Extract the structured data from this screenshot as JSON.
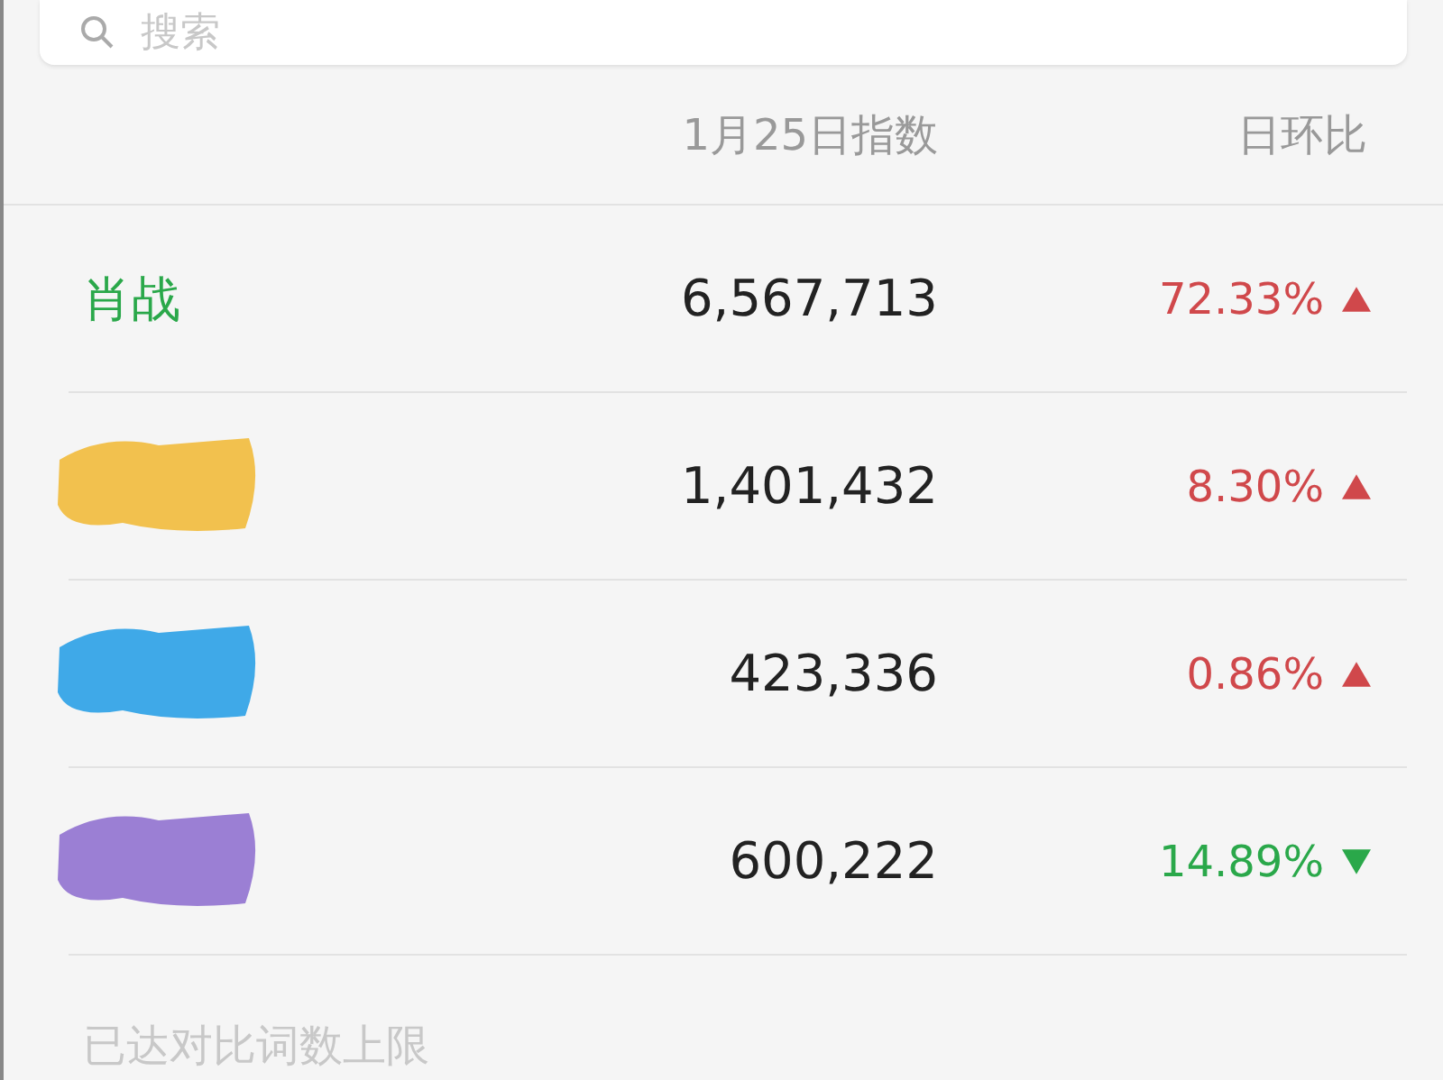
{
  "search": {
    "placeholder": "搜索"
  },
  "table": {
    "columns": [
      {
        "label": "1月25日指数"
      },
      {
        "label": "日环比"
      }
    ],
    "rows": [
      {
        "kind": "text",
        "name": "肖战",
        "index": "6,567,713",
        "change": "72.33%",
        "rising": true
      },
      {
        "kind": "redacted",
        "color": "#f2c14e",
        "index": "1,401,432",
        "change": "8.30%",
        "rising": true
      },
      {
        "kind": "redacted",
        "color": "#3fa9e8",
        "index": "423,336",
        "change": "0.86%",
        "rising": true
      },
      {
        "kind": "redacted",
        "color": "#9b7fd4",
        "index": "600,222",
        "change": "14.89%",
        "rising": false
      }
    ]
  },
  "footer": "已达对比词数上限"
}
